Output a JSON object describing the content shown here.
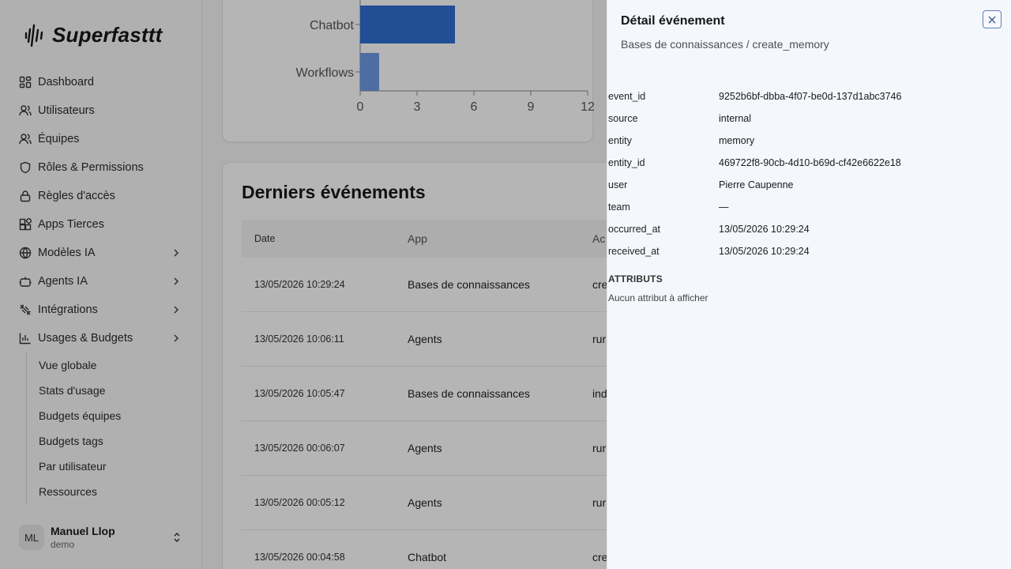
{
  "brand": {
    "name": "Superfasttt"
  },
  "sidebar": {
    "items": [
      {
        "label": "Dashboard",
        "icon": "dashboard-icon"
      },
      {
        "label": "Utilisateurs",
        "icon": "user-icon"
      },
      {
        "label": "Équipes",
        "icon": "team-icon"
      },
      {
        "label": "Rôles & Permissions",
        "icon": "shield-icon"
      },
      {
        "label": "Règles d'accès",
        "icon": "lock-icon"
      },
      {
        "label": "Apps Tierces",
        "icon": "apps-icon"
      },
      {
        "label": "Modèles IA",
        "icon": "globe-icon"
      },
      {
        "label": "Agents IA",
        "icon": "bot-icon"
      },
      {
        "label": "Intégrations",
        "icon": "plug-icon"
      },
      {
        "label": "Usages & Budgets",
        "icon": "bar-chart-icon"
      }
    ],
    "sub_items": [
      {
        "label": "Vue globale"
      },
      {
        "label": "Stats d'usage"
      },
      {
        "label": "Budgets équipes"
      },
      {
        "label": "Budgets tags"
      },
      {
        "label": "Par utilisateur"
      },
      {
        "label": "Ressources"
      }
    ],
    "user": {
      "initials": "ML",
      "name": "Manuel Llop",
      "org": "demo"
    }
  },
  "chart_data": {
    "type": "bar",
    "orientation": "horizontal",
    "categories": [
      "Chatbot",
      "Workflows"
    ],
    "values": [
      5,
      1
    ],
    "xlim": [
      0,
      12
    ],
    "xticks": [
      0,
      3,
      6,
      9,
      12
    ],
    "colors": [
      "#2f6fd1",
      "#6f9ae4"
    ],
    "title": "",
    "xlabel": "",
    "ylabel": ""
  },
  "events": {
    "title": "Derniers événements",
    "columns": {
      "date": "Date",
      "app": "App",
      "action": "Ac"
    },
    "rows": [
      {
        "date": "13/05/2026 10:29:24",
        "app": "Bases de connaissances",
        "action": "cre"
      },
      {
        "date": "13/05/2026 10:06:11",
        "app": "Agents",
        "action": "rur"
      },
      {
        "date": "13/05/2026 10:05:47",
        "app": "Bases de connaissances",
        "action": "ind"
      },
      {
        "date": "13/05/2026 00:06:07",
        "app": "Agents",
        "action": "rur"
      },
      {
        "date": "13/05/2026 00:05:12",
        "app": "Agents",
        "action": "rur"
      },
      {
        "date": "13/05/2026 00:04:58",
        "app": "Chatbot",
        "action": "cre"
      }
    ]
  },
  "panel": {
    "title": "Détail événement",
    "subtitle": "Bases de connaissances / create_memory",
    "fields": [
      {
        "key": "event_id",
        "value": "9252b6bf-dbba-4f07-be0d-137d1abc3746"
      },
      {
        "key": "source",
        "value": "internal"
      },
      {
        "key": "entity",
        "value": "memory"
      },
      {
        "key": "entity_id",
        "value": "469722f8-90cb-4d10-b69d-cf42e6622e18"
      },
      {
        "key": "user",
        "value": "Pierre Caupenne"
      },
      {
        "key": "team",
        "value": "—"
      },
      {
        "key": "occurred_at",
        "value": "13/05/2026 10:29:24"
      },
      {
        "key": "received_at",
        "value": "13/05/2026 10:29:24"
      }
    ],
    "attributes_title": "ATTRIBUTS",
    "attributes_empty": "Aucun attribut à afficher"
  }
}
